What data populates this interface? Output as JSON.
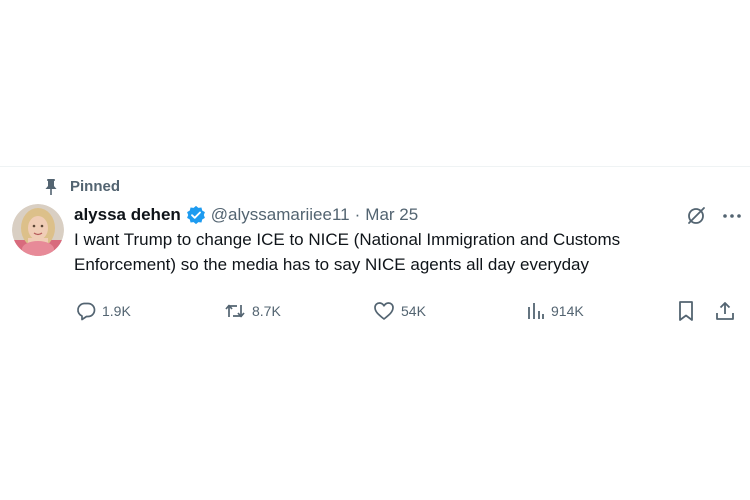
{
  "pinned_label": "Pinned",
  "author": {
    "display_name": "alyssa dehen",
    "handle": "@alyssamariiee11",
    "verified": true
  },
  "separator": "·",
  "date": "Mar 25",
  "text": "I want Trump to change ICE to NICE (National Immigration and Customs Enforcement) so the media has to say NICE agents all day everyday",
  "metrics": {
    "replies": "1.9K",
    "reposts": "8.7K",
    "likes": "54K",
    "views": "914K"
  },
  "icons": {
    "pin": "pin-icon",
    "verified": "verified-badge-icon",
    "grok": "grok-icon",
    "more": "more-icon",
    "reply": "reply-icon",
    "repost": "repost-icon",
    "like": "heart-icon",
    "views": "views-icon",
    "bookmark": "bookmark-icon",
    "share": "share-icon"
  },
  "colors": {
    "text_primary": "#0f1419",
    "text_secondary": "#536471",
    "verified_blue": "#1d9bf0",
    "divider": "#eff3f4"
  }
}
